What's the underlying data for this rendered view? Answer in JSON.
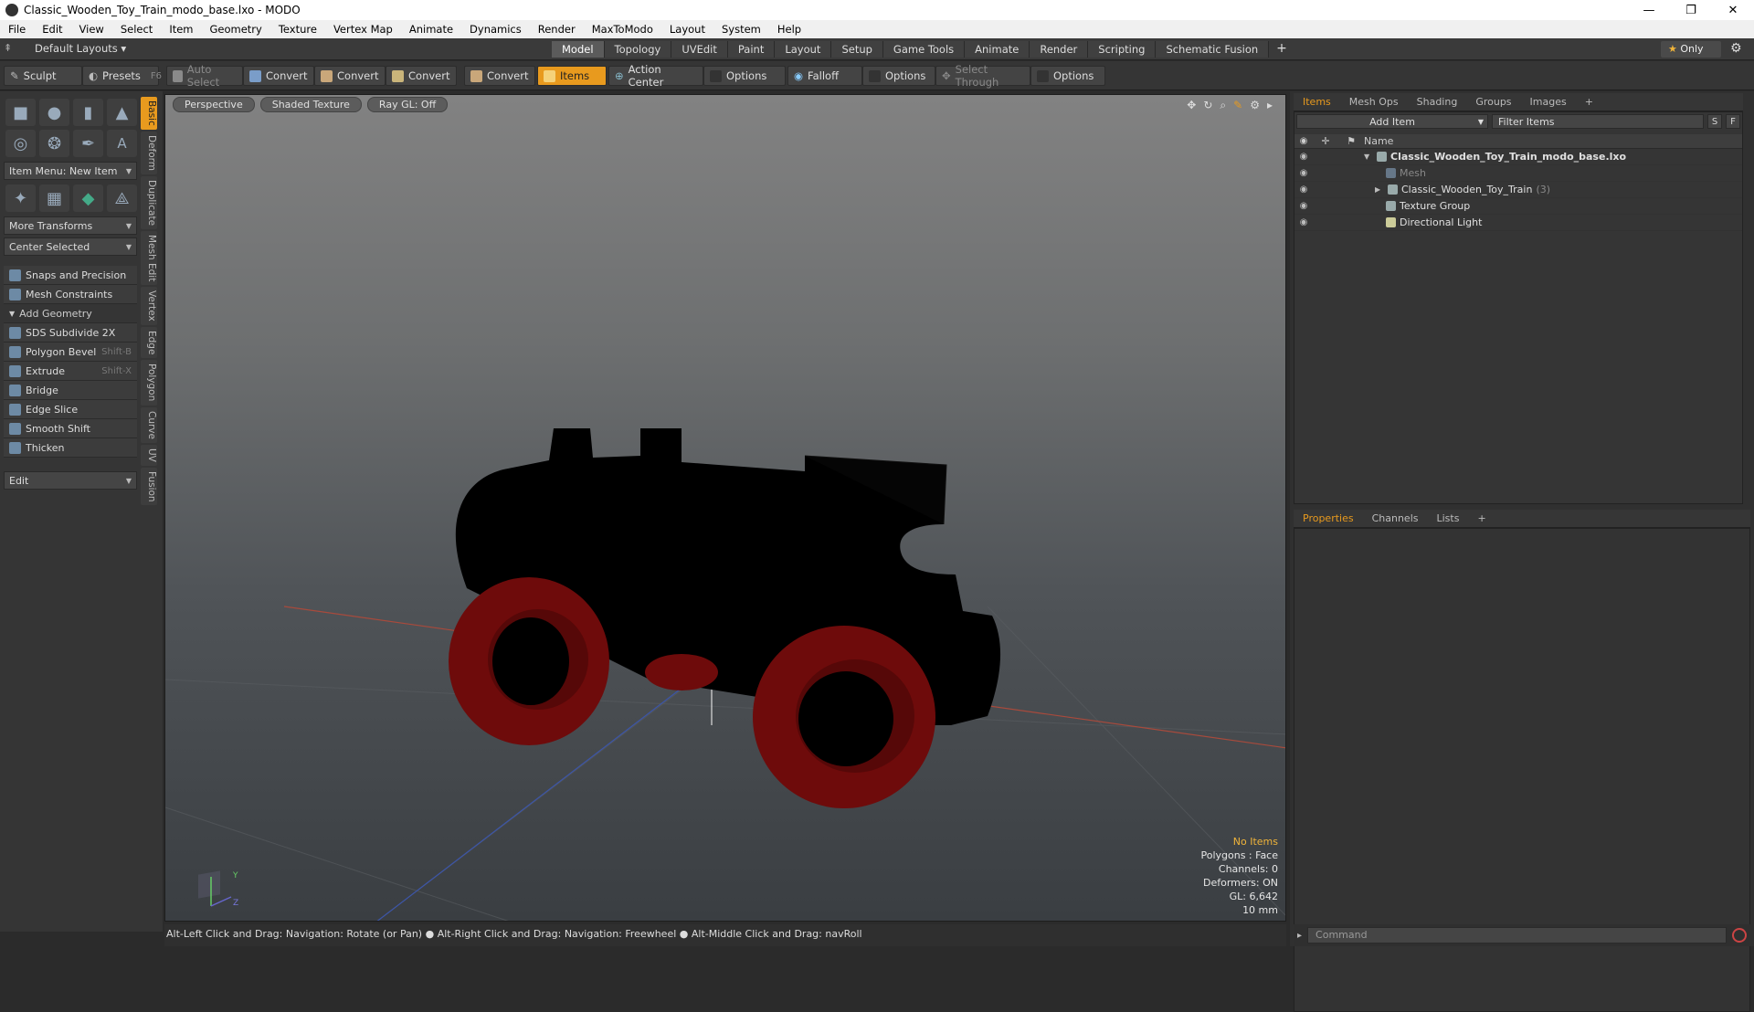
{
  "window": {
    "title": "Classic_Wooden_Toy_Train_modo_base.lxo - MODO",
    "controls": [
      "—",
      "❐",
      "✕"
    ]
  },
  "menu": [
    "File",
    "Edit",
    "View",
    "Select",
    "Item",
    "Geometry",
    "Texture",
    "Vertex Map",
    "Animate",
    "Dynamics",
    "Render",
    "MaxToModo",
    "Layout",
    "System",
    "Help"
  ],
  "layoutbar": {
    "default_layouts": "Default Layouts ▾",
    "tabs": [
      "Model",
      "Topology",
      "UVEdit",
      "Paint",
      "Layout",
      "Setup",
      "Game Tools",
      "Animate",
      "Render",
      "Scripting",
      "Schematic Fusion"
    ],
    "active_tab": "Model",
    "add": "+",
    "only": "Only"
  },
  "toolbar": {
    "sculpt": "Sculpt",
    "presets": "Presets",
    "presets_sc": "F6",
    "auto_select": "Auto Select",
    "convert1": "Convert",
    "convert2": "Convert",
    "convert3": "Convert",
    "convert4": "Convert",
    "items": "Items",
    "action_center": "Action Center",
    "options1": "Options",
    "falloff": "Falloff",
    "options2": "Options",
    "select_through": "Select Through",
    "options3": "Options"
  },
  "leftpanel": {
    "item_menu": "Item Menu: New Item",
    "more_transforms": "More Transforms",
    "center_selected": "Center Selected",
    "snaps": "Snaps and Precision",
    "mesh_constraints": "Mesh Constraints",
    "add_geometry": "Add Geometry",
    "tools": [
      {
        "label": "SDS Subdivide 2X",
        "sc": ""
      },
      {
        "label": "Polygon Bevel",
        "sc": "Shift-B"
      },
      {
        "label": "Extrude",
        "sc": "Shift-X"
      },
      {
        "label": "Bridge",
        "sc": ""
      },
      {
        "label": "Edge Slice",
        "sc": ""
      },
      {
        "label": "Smooth Shift",
        "sc": ""
      },
      {
        "label": "Thicken",
        "sc": ""
      }
    ],
    "edit": "Edit",
    "vtabs": [
      "Basic",
      "Deform",
      "Duplicate",
      "Mesh Edit",
      "Vertex",
      "Edge",
      "Polygon",
      "Curve",
      "UV",
      "Fusion"
    ]
  },
  "viewport": {
    "view": "Perspective",
    "shading": "Shaded Texture",
    "raygl": "Ray GL: Off",
    "info": {
      "no_items": "No Items",
      "polygons": "Polygons : Face",
      "channels": "Channels: 0",
      "deformers": "Deformers: ON",
      "gl": "GL: 6,642",
      "unit": "10 mm"
    },
    "axis": {
      "y": "Y",
      "z": "Z"
    }
  },
  "status": "Alt-Left Click and Drag: Navigation: Rotate (or Pan) ● Alt-Right Click and Drag: Navigation: Freewheel ● Alt-Middle Click and Drag: navRoll",
  "items_panel": {
    "tabs": [
      "Items",
      "Mesh Ops",
      "Shading",
      "Groups",
      "Images",
      "+"
    ],
    "add_item": "Add Item",
    "filter": "Filter Items",
    "s": "S",
    "f": "F",
    "col_name": "Name",
    "rows": [
      {
        "name": "Classic_Wooden_Toy_Train_modo_base.lxo",
        "count": ""
      },
      {
        "name": "Mesh",
        "count": ""
      },
      {
        "name": "Classic_Wooden_Toy_Train",
        "count": "(3)"
      },
      {
        "name": "Texture Group",
        "count": ""
      },
      {
        "name": "Directional Light",
        "count": ""
      }
    ]
  },
  "props_panel": {
    "tabs": [
      "Properties",
      "Channels",
      "Lists",
      "+"
    ]
  },
  "command": {
    "placeholder": "Command"
  },
  "colors": {
    "accent": "#e89a1e",
    "wheel": "#6e0b0b",
    "body": "#000000"
  }
}
